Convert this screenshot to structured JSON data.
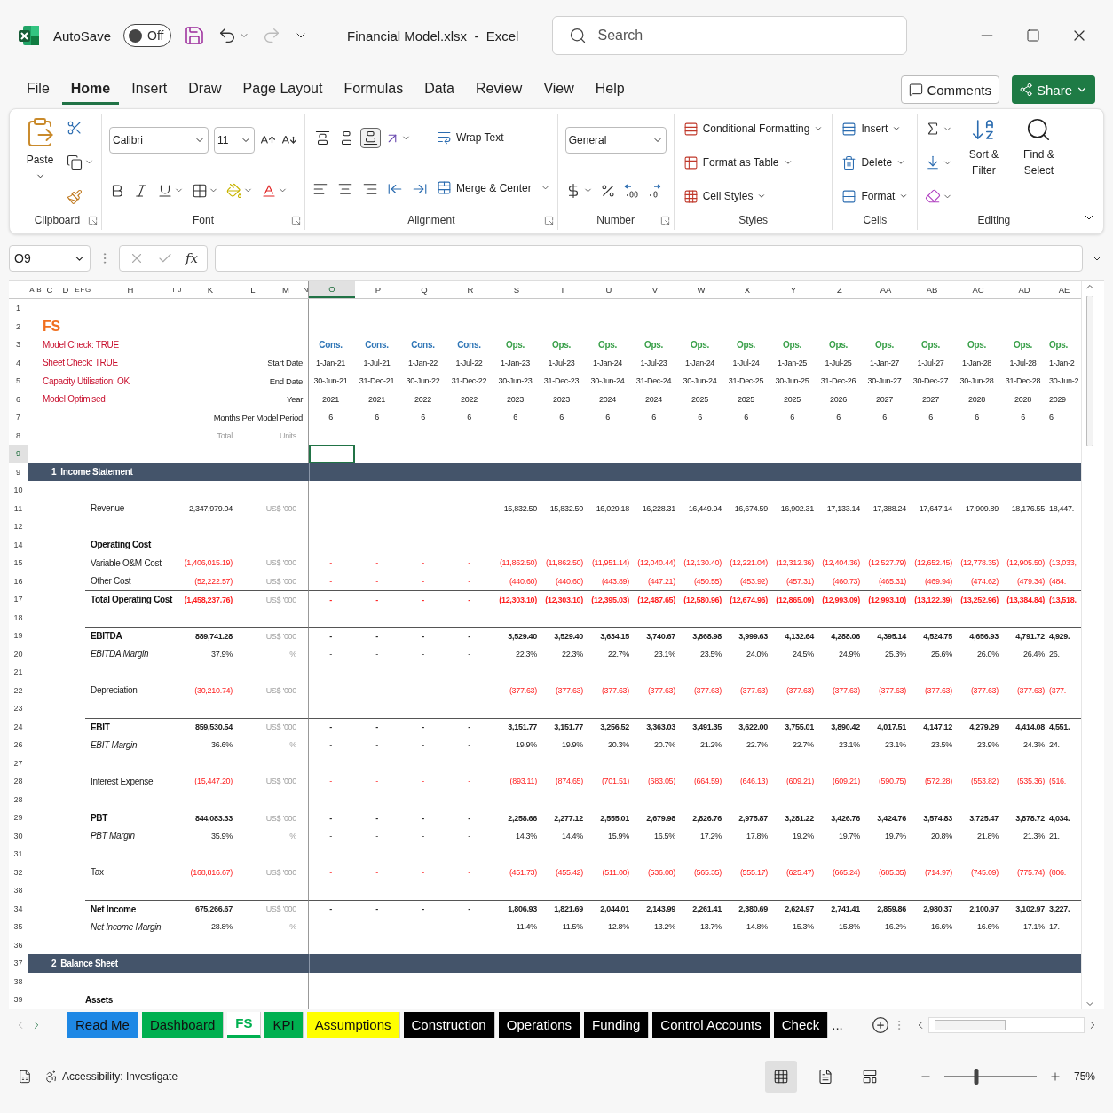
{
  "title_bar": {
    "autosave": {
      "label": "AutoSave",
      "state": "Off",
      "on": false
    },
    "title": "Financial Model.xlsx  -  Excel",
    "search": {
      "placeholder": "Search"
    }
  },
  "menu": {
    "tabs": [
      {
        "label": "File",
        "selected": false
      },
      {
        "label": "Home",
        "selected": true
      },
      {
        "label": "Insert",
        "selected": false
      },
      {
        "label": "Draw",
        "selected": false
      },
      {
        "label": "Page Layout",
        "selected": false
      },
      {
        "label": "Formulas",
        "selected": false
      },
      {
        "label": "Data",
        "selected": false
      },
      {
        "label": "Review",
        "selected": false
      },
      {
        "label": "View",
        "selected": false
      },
      {
        "label": "Help",
        "selected": false
      }
    ],
    "comments": "Comments",
    "share": "Share"
  },
  "ribbon": {
    "clipboard": {
      "paste": "Paste",
      "label": "Clipboard",
      "launcher": true
    },
    "font": {
      "font": "Calibri",
      "size": "11",
      "label": "Font",
      "launcher": true
    },
    "alignment": {
      "vertical": [
        {
          "selected": false
        },
        {
          "selected": false
        },
        {
          "selected": true
        }
      ],
      "wrap": "Wrap Text",
      "merge": "Merge & Center",
      "label": "Alignment",
      "launcher": true
    },
    "number": {
      "format": "General",
      "label": "Number",
      "launcher": true
    },
    "styles": {
      "items": [
        "Conditional Formatting",
        "Format as Table",
        "Cell Styles"
      ],
      "label": "Styles"
    },
    "cells": {
      "items": [
        "Insert",
        "Delete",
        "Format"
      ],
      "label": "Cells"
    },
    "editing": {
      "sort": "Sort & Filter",
      "find": "Find & Select",
      "label": "Editing"
    }
  },
  "formula_bar": {
    "name_box": "O9",
    "fx": "fx"
  },
  "grid": {
    "columns": [
      {
        "label": "A",
        "selected": false
      },
      {
        "label": "B",
        "selected": false
      },
      {
        "label": "C",
        "selected": false
      },
      {
        "label": "D",
        "selected": false
      },
      {
        "label": "E",
        "selected": false
      },
      {
        "label": "F",
        "selected": false
      },
      {
        "label": "G",
        "selected": false
      },
      {
        "label": "H",
        "selected": false
      },
      {
        "label": "I",
        "selected": false
      },
      {
        "label": "J",
        "selected": false
      },
      {
        "label": "K",
        "selected": false
      },
      {
        "label": "L",
        "selected": false
      },
      {
        "label": "M",
        "selected": false
      },
      {
        "label": "N",
        "selected": false
      },
      {
        "label": "O",
        "selected": true
      },
      {
        "label": "P",
        "selected": false
      },
      {
        "label": "Q",
        "selected": false
      },
      {
        "label": "R",
        "selected": false
      },
      {
        "label": "S",
        "selected": false
      },
      {
        "label": "T",
        "selected": false
      },
      {
        "label": "U",
        "selected": false
      },
      {
        "label": "V",
        "selected": false
      },
      {
        "label": "W",
        "selected": false
      },
      {
        "label": "X",
        "selected": false
      },
      {
        "label": "Y",
        "selected": false
      },
      {
        "label": "Z",
        "selected": false
      },
      {
        "label": "AA",
        "selected": false
      },
      {
        "label": "AB",
        "selected": false
      },
      {
        "label": "AC",
        "selected": false
      },
      {
        "label": "AD",
        "selected": false
      },
      {
        "label": "AE",
        "selected": false
      }
    ],
    "rows": [
      {
        "num": "1",
        "kind": "blank",
        "selected": false
      },
      {
        "num": "2",
        "kind": "title",
        "label": "FS",
        "selected": false
      },
      {
        "num": "3",
        "kind": "check",
        "label": "Model Check: TRUE",
        "selected": false,
        "values": [
          {
            "text": "Cons.",
            "color": "#2e75b6"
          },
          {
            "text": "Cons.",
            "color": "#2e75b6"
          },
          {
            "text": "Cons.",
            "color": "#2e75b6"
          },
          {
            "text": "Cons.",
            "color": "#2e75b6"
          },
          {
            "text": "Ops.",
            "color": "#3aa04a"
          },
          {
            "text": "Ops.",
            "color": "#3aa04a"
          },
          {
            "text": "Ops.",
            "color": "#3aa04a"
          },
          {
            "text": "Ops.",
            "color": "#3aa04a"
          },
          {
            "text": "Ops.",
            "color": "#3aa04a"
          },
          {
            "text": "Ops.",
            "color": "#3aa04a"
          },
          {
            "text": "Ops.",
            "color": "#3aa04a"
          },
          {
            "text": "Ops.",
            "color": "#3aa04a"
          },
          {
            "text": "Ops.",
            "color": "#3aa04a"
          },
          {
            "text": "Ops.",
            "color": "#3aa04a"
          },
          {
            "text": "Ops.",
            "color": "#3aa04a"
          },
          {
            "text": "Ops.",
            "color": "#3aa04a"
          },
          {
            "text": "Ops.",
            "color": "#3aa04a"
          }
        ]
      },
      {
        "num": "4",
        "kind": "check",
        "label": "Sheet Check: TRUE",
        "caption": "Start Date",
        "selected": false,
        "values": [
          "1-Jan-21",
          "1-Jul-21",
          "1-Jan-22",
          "1-Jul-22",
          "1-Jan-23",
          "1-Jul-23",
          "1-Jan-24",
          "1-Jul-23",
          "1-Jan-24",
          "1-Jul-24",
          "1-Jan-25",
          "1-Jul-25",
          "1-Jan-27",
          "1-Jul-27",
          "1-Jan-28",
          "1-Jul-28",
          "1-Jan-2"
        ]
      },
      {
        "num": "5",
        "kind": "check",
        "label": "Capacity Utilisation: OK",
        "caption": "End Date",
        "selected": false,
        "values": [
          "30-Jun-21",
          "31-Dec-21",
          "30-Jun-22",
          "31-Dec-22",
          "30-Jun-23",
          "31-Dec-23",
          "30-Jun-24",
          "31-Dec-24",
          "30-Jun-24",
          "31-Dec-25",
          "30-Jun-25",
          "31-Dec-26",
          "30-Jun-27",
          "30-Dec-27",
          "30-Jun-28",
          "31-Dec-28",
          "30-Jun-2"
        ]
      },
      {
        "num": "6",
        "kind": "check",
        "label": "Model Optimised",
        "caption": "Year",
        "selected": false,
        "values": [
          "2021",
          "2021",
          "2022",
          "2022",
          "2023",
          "2023",
          "2024",
          "2024",
          "2025",
          "2025",
          "2025",
          "2026",
          "2027",
          "2027",
          "2028",
          "2028",
          "2029"
        ]
      },
      {
        "num": "7",
        "kind": "blank",
        "caption": "Months Per Model Period",
        "selected": false,
        "values": [
          "6",
          "6",
          "6",
          "6",
          "6",
          "6",
          "6",
          "6",
          "6",
          "6",
          "6",
          "6",
          "6",
          "6",
          "6",
          "6",
          "6"
        ]
      },
      {
        "num": "8",
        "kind": "captions",
        "total": "Total",
        "units": "Units",
        "selected": false
      },
      {
        "num": "9",
        "kind": "blank",
        "selected": true
      },
      {
        "num": "9",
        "kind": "section",
        "label": "1  Income Statement",
        "selected": false
      },
      {
        "num": "10",
        "kind": "blank",
        "selected": false
      },
      {
        "num": "11",
        "kind": "item",
        "label": "Revenue",
        "total": "2,347,979.04",
        "units": "US$ '000",
        "selected": false,
        "values": [
          "-",
          "-",
          "-",
          "-",
          "15,832.50",
          "15,832.50",
          "16,029.18",
          "16,228.31",
          "16,449.94",
          "16,674.59",
          "16,902.31",
          "17,133.14",
          "17,388.24",
          "17,647.14",
          "17,909.89",
          "18,176.55",
          "18,447."
        ]
      },
      {
        "num": "12",
        "kind": "blank",
        "selected": false
      },
      {
        "num": "14",
        "kind": "heading",
        "label": "Operating Cost",
        "selected": false
      },
      {
        "num": "15",
        "kind": "item",
        "label": "Variable O&M Cost",
        "total": "(1,406,015.19)",
        "units": "US$ '000",
        "negative": true,
        "selected": false,
        "values": [
          "-",
          "-",
          "-",
          "-",
          "(11,862.50)",
          "(11,862.50)",
          "(11,951.14)",
          "(12,040.44)",
          "(12,130.40)",
          "(12,221.04)",
          "(12,312.36)",
          "(12,404.36)",
          "(12,527.79)",
          "(12,652.45)",
          "(12,778.35)",
          "(12,905.50)",
          "(13,033,"
        ]
      },
      {
        "num": "16",
        "kind": "item",
        "label": "Other Cost",
        "total": "(52,222.57)",
        "units": "US$ '000",
        "negative": true,
        "selected": false,
        "values": [
          "-",
          "-",
          "-",
          "-",
          "(440.60)",
          "(440.60)",
          "(443.89)",
          "(447.21)",
          "(450.55)",
          "(453.92)",
          "(457.31)",
          "(460.73)",
          "(465.31)",
          "(469.94)",
          "(474.62)",
          "(479.34)",
          "(484."
        ]
      },
      {
        "num": "17",
        "kind": "total",
        "rule": true,
        "label": "Total Operating Cost",
        "total": "(1,458,237.76)",
        "units": "US$ '000",
        "negative": true,
        "selected": false,
        "values": [
          "-",
          "-",
          "-",
          "-",
          "(12,303.10)",
          "(12,303.10)",
          "(12,395.03)",
          "(12,487.65)",
          "(12,580.96)",
          "(12,674.96)",
          "(12,865.09)",
          "(12,993.09)",
          "(12,993.10)",
          "(13,122.39)",
          "(13,252.96)",
          "(13,384.84)",
          "(13,518."
        ]
      },
      {
        "num": "18",
        "kind": "blank",
        "selected": false
      },
      {
        "num": "19",
        "kind": "total",
        "rule": true,
        "label": "EBITDA",
        "total": "889,741.28",
        "units": "US$ '000",
        "selected": false,
        "values": [
          "-",
          "-",
          "-",
          "-",
          "3,529.40",
          "3,529.40",
          "3,634.15",
          "3,740.67",
          "3,868.98",
          "3,999.63",
          "4,132.64",
          "4,288.06",
          "4,395.14",
          "4,524.75",
          "4,656.93",
          "4,791.72",
          "4,929."
        ]
      },
      {
        "num": "20",
        "kind": "margin",
        "label": "EBITDA Margin",
        "total": "37.9%",
        "units": "%",
        "selected": false,
        "values": [
          "-",
          "-",
          "-",
          "-",
          "22.3%",
          "22.3%",
          "22.7%",
          "23.1%",
          "23.5%",
          "24.0%",
          "24.5%",
          "24.9%",
          "25.3%",
          "25.6%",
          "26.0%",
          "26.4%",
          "26."
        ]
      },
      {
        "num": "21",
        "kind": "blank",
        "selected": false
      },
      {
        "num": "22",
        "kind": "item",
        "label": "Depreciation",
        "total": "(30,210.74)",
        "units": "US$ '000",
        "negative": true,
        "selected": false,
        "values": [
          "-",
          "-",
          "-",
          "-",
          "(377.63)",
          "(377.63)",
          "(377.63)",
          "(377.63)",
          "(377.63)",
          "(377.63)",
          "(377.63)",
          "(377.63)",
          "(377.63)",
          "(377.63)",
          "(377.63)",
          "(377.63)",
          "(377."
        ]
      },
      {
        "num": "23",
        "kind": "blank",
        "selected": false
      },
      {
        "num": "24",
        "kind": "total",
        "rule": true,
        "label": "EBIT",
        "total": "859,530.54",
        "units": "US$ '000",
        "selected": false,
        "values": [
          "-",
          "-",
          "-",
          "-",
          "3,151.77",
          "3,151.77",
          "3,256.52",
          "3,363.03",
          "3,491.35",
          "3,622.00",
          "3,755.01",
          "3,890.42",
          "4,017.51",
          "4,147.12",
          "4,279.29",
          "4,414.08",
          "4,551."
        ]
      },
      {
        "num": "26",
        "kind": "margin",
        "label": "EBIT Margin",
        "total": "36.6%",
        "units": "%",
        "selected": false,
        "values": [
          "-",
          "-",
          "-",
          "-",
          "19.9%",
          "19.9%",
          "20.3%",
          "20.7%",
          "21.2%",
          "22.7%",
          "22.7%",
          "23.1%",
          "23.1%",
          "23.5%",
          "23.9%",
          "24.3%",
          "24."
        ]
      },
      {
        "num": "27",
        "kind": "blank",
        "selected": false
      },
      {
        "num": "28",
        "kind": "item",
        "label": "Interest Expense",
        "total": "(15,447.20)",
        "units": "US$ '000",
        "negative": true,
        "selected": false,
        "values": [
          "-",
          "-",
          "-",
          "-",
          "(893.11)",
          "(874.65)",
          "(701.51)",
          "(683.05)",
          "(664.59)",
          "(646.13)",
          "(609.21)",
          "(609.21)",
          "(590.75)",
          "(572.28)",
          "(553.82)",
          "(535.36)",
          "(516."
        ]
      },
      {
        "num": "28",
        "kind": "blank",
        "selected": false
      },
      {
        "num": "29",
        "kind": "total",
        "rule": true,
        "label": "PBT",
        "total": "844,083.33",
        "units": "US$ '000",
        "selected": false,
        "values": [
          "-",
          "-",
          "-",
          "-",
          "2,258.66",
          "2,277.12",
          "2,555.01",
          "2,679.98",
          "2,826.76",
          "2,975.87",
          "3,281.22",
          "3,426.76",
          "3,424.76",
          "3,574.83",
          "3,725.47",
          "3,878.72",
          "4,034."
        ]
      },
      {
        "num": "30",
        "kind": "margin",
        "label": "PBT Margin",
        "total": "35.9%",
        "units": "%",
        "selected": false,
        "values": [
          "-",
          "-",
          "-",
          "-",
          "14.3%",
          "14.4%",
          "15.9%",
          "16.5%",
          "17.2%",
          "17.8%",
          "19.2%",
          "19.7%",
          "19.7%",
          "20.8%",
          "21.8%",
          "21.3%",
          "21."
        ]
      },
      {
        "num": "31",
        "kind": "blank",
        "selected": false
      },
      {
        "num": "32",
        "kind": "item",
        "label": "Tax",
        "total": "(168,816.67)",
        "units": "US$ '000",
        "negative": true,
        "selected": false,
        "values": [
          "-",
          "-",
          "-",
          "-",
          "(451.73)",
          "(455.42)",
          "(511.00)",
          "(536.00)",
          "(565.35)",
          "(555.17)",
          "(625.47)",
          "(665.24)",
          "(685.35)",
          "(714.97)",
          "(745.09)",
          "(775.74)",
          "(806."
        ]
      },
      {
        "num": "38",
        "kind": "blank",
        "selected": false
      },
      {
        "num": "34",
        "kind": "total",
        "rule": true,
        "label": "Net Income",
        "total": "675,266.67",
        "units": "US$ '000",
        "selected": false,
        "values": [
          "-",
          "-",
          "-",
          "-",
          "1,806.93",
          "1,821.69",
          "2,044.01",
          "2,143.99",
          "2,261.41",
          "2,380.69",
          "2,624.97",
          "2,741.41",
          "2,859.86",
          "2,980.37",
          "2,100.97",
          "3,102.97",
          "3,227."
        ]
      },
      {
        "num": "35",
        "kind": "margin",
        "label": "Net Income Margin",
        "total": "28.8%",
        "units": "%",
        "selected": false,
        "values": [
          "-",
          "-",
          "-",
          "-",
          "11.4%",
          "11.5%",
          "12.8%",
          "13.2%",
          "13.7%",
          "14.8%",
          "15.3%",
          "15.8%",
          "16.2%",
          "16.6%",
          "16.6%",
          "17.1%",
          "17."
        ]
      },
      {
        "num": "36",
        "kind": "blank",
        "selected": false
      },
      {
        "num": "37",
        "kind": "section",
        "label": "2  Balance Sheet",
        "selected": false
      },
      {
        "num": "38",
        "kind": "blank",
        "selected": false
      },
      {
        "num": "39",
        "kind": "group",
        "label": "Assets",
        "selected": false
      }
    ]
  },
  "sheet_tabs": {
    "tabs": [
      {
        "label": "Read Me",
        "color": "#1e88e5",
        "selected": false
      },
      {
        "label": "Dashboard",
        "color": "#00b050",
        "selected": false
      },
      {
        "label": "FS",
        "color": "#00b050",
        "selected": true
      },
      {
        "label": "KPI",
        "color": "#00b050",
        "selected": false
      },
      {
        "label": "Assumptions",
        "color": "#ffff00",
        "selected": false
      },
      {
        "label": "Construction",
        "color": "#000000",
        "selected": false
      },
      {
        "label": "Operations",
        "color": "#000000",
        "selected": false
      },
      {
        "label": "Funding",
        "color": "#000000",
        "selected": false
      },
      {
        "label": "Control Accounts",
        "color": "#000000",
        "selected": false
      },
      {
        "label": "Check",
        "color": "#000000",
        "selected": false
      }
    ],
    "more": "..."
  },
  "status_bar": {
    "accessibility": "Accessibility: Investigate",
    "views": [
      {
        "kind": "normal",
        "selected": true
      },
      {
        "kind": "page_layout",
        "selected": false
      },
      {
        "kind": "page_break",
        "selected": false
      }
    ],
    "zoom": {
      "level": 0.35,
      "label": "75%"
    }
  }
}
